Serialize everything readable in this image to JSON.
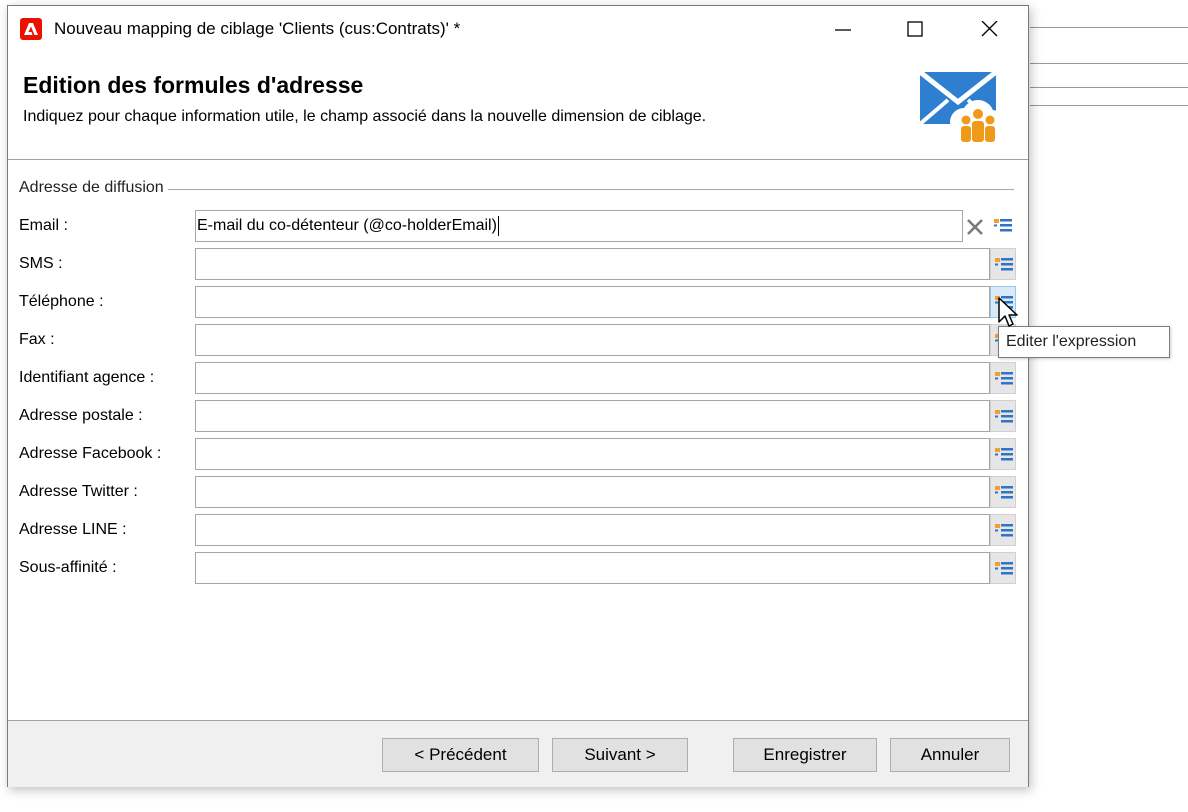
{
  "window": {
    "title": "Nouveau mapping de ciblage 'Clients (cus:Contrats)' *",
    "accent": "#eb1000"
  },
  "header": {
    "title": "Edition des formules d'adresse",
    "subtitle": "Indiquez pour chaque information utile, le champ associé dans la nouvelle dimension de ciblage.",
    "icon": "mail-audience-icon"
  },
  "group": {
    "label": "Adresse de diffusion"
  },
  "fields": [
    {
      "label": "Email :",
      "value": "E-mail du co-détenteur (@co-holderEmail)"
    },
    {
      "label": "SMS :",
      "value": ""
    },
    {
      "label": "Téléphone :",
      "value": ""
    },
    {
      "label": "Fax :",
      "value": ""
    },
    {
      "label": "Identifiant agence :",
      "value": ""
    },
    {
      "label": "Adresse postale :",
      "value": ""
    },
    {
      "label": "Adresse Facebook :",
      "value": ""
    },
    {
      "label": "Adresse Twitter :",
      "value": ""
    },
    {
      "label": "Adresse LINE :",
      "value": ""
    },
    {
      "label": "Sous-affinité :",
      "value": ""
    }
  ],
  "tooltip": {
    "text": "Editer l'expression"
  },
  "buttons": {
    "previous": "< Précédent",
    "next": "Suivant >",
    "save": "Enregistrer",
    "cancel": "Annuler"
  }
}
